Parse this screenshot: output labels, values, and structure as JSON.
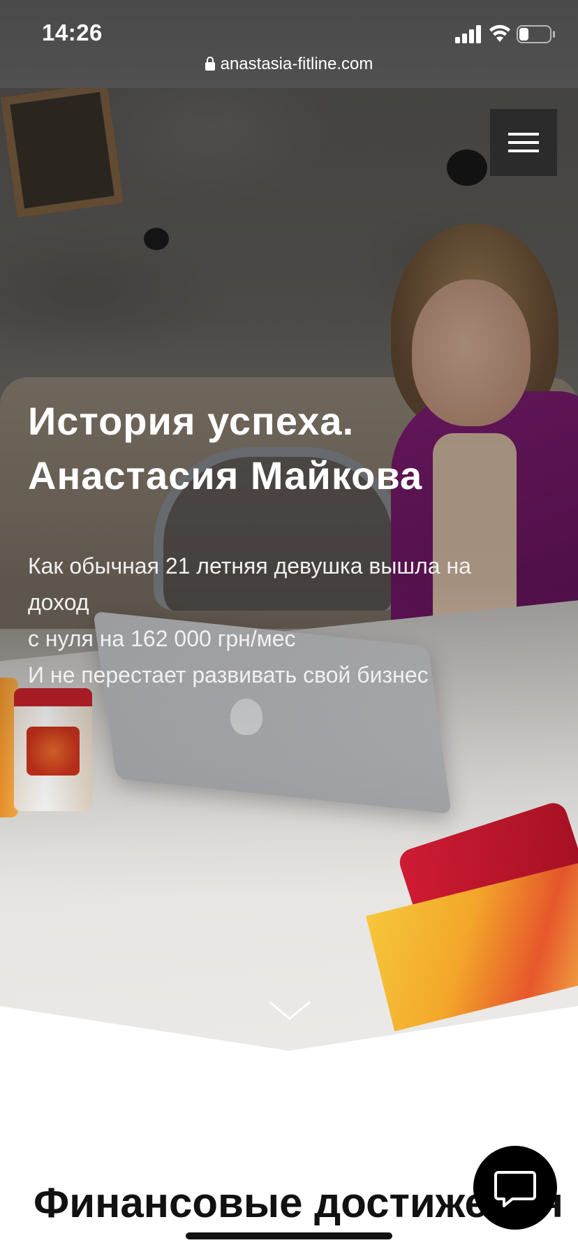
{
  "status_bar": {
    "time": "14:26",
    "signal_icon": "cellular-signal-icon",
    "wifi_icon": "wifi-icon",
    "battery_icon": "battery-icon",
    "battery_level": 0.3
  },
  "browser": {
    "url": "anastasia-fitline.com",
    "lock_icon": "lock-icon"
  },
  "header": {
    "menu_icon": "hamburger-menu-icon"
  },
  "hero": {
    "title_line1": "История успеха.",
    "title_line2": "Анастасия Майкова",
    "desc_line1": "Как обычная 21 летняя девушка вышла на",
    "desc_line2": "доход",
    "desc_line3": "с нуля на 162 000 грн/мес",
    "desc_line4": "И не перестает развивать свой бизнес",
    "scroll_icon": "chevron-down-icon"
  },
  "section": {
    "heading": "Финансовые достижения"
  },
  "chat": {
    "icon": "chat-bubble-icon"
  },
  "colors": {
    "status_bar_bg": "#4a4a4a",
    "menu_bg": "#2b2b2b",
    "jacket_accent": "#8a1f7c",
    "chat_bg": "#000000",
    "page_bg": "#ffffff"
  }
}
